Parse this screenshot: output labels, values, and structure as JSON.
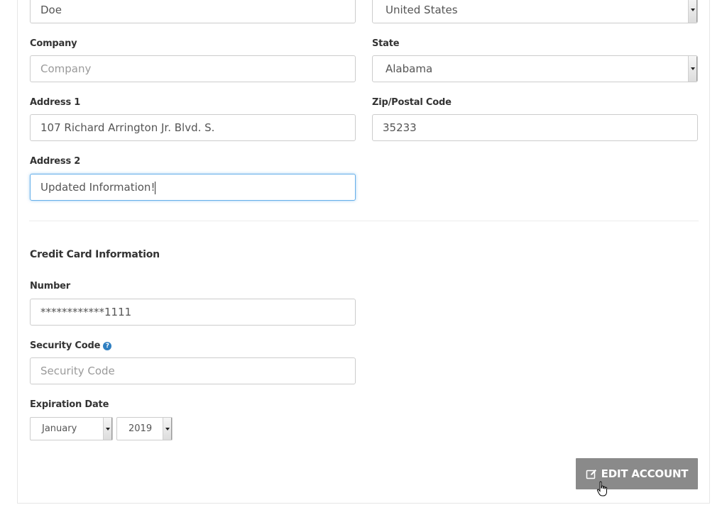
{
  "billing": {
    "last_name_value": "Doe",
    "country_value": "United States",
    "company_label": "Company",
    "company_placeholder": "Company",
    "state_label": "State",
    "state_value": "Alabama",
    "address1_label": "Address 1",
    "address1_value": "107 Richard Arrington Jr. Blvd. S.",
    "zip_label": "Zip/Postal Code",
    "zip_value": "35233",
    "address2_label": "Address 2",
    "address2_value": "Updated Information!"
  },
  "credit_card": {
    "heading": "Credit Card Information",
    "number_label": "Number",
    "number_value": "************1111",
    "security_label": "Security Code",
    "security_placeholder": "Security Code",
    "expiration_label": "Expiration Date",
    "month_value": "January",
    "year_value": "2019"
  },
  "actions": {
    "edit_account_label": "EDIT ACCOUNT"
  },
  "icons": {
    "help": "question-circle-icon",
    "edit": "edit-icon",
    "cursor": "hand-pointer-cursor"
  },
  "colors": {
    "focus_border": "#66afe9",
    "button_bg": "#8a8a8a",
    "help_icon": "#2f7fc1"
  }
}
